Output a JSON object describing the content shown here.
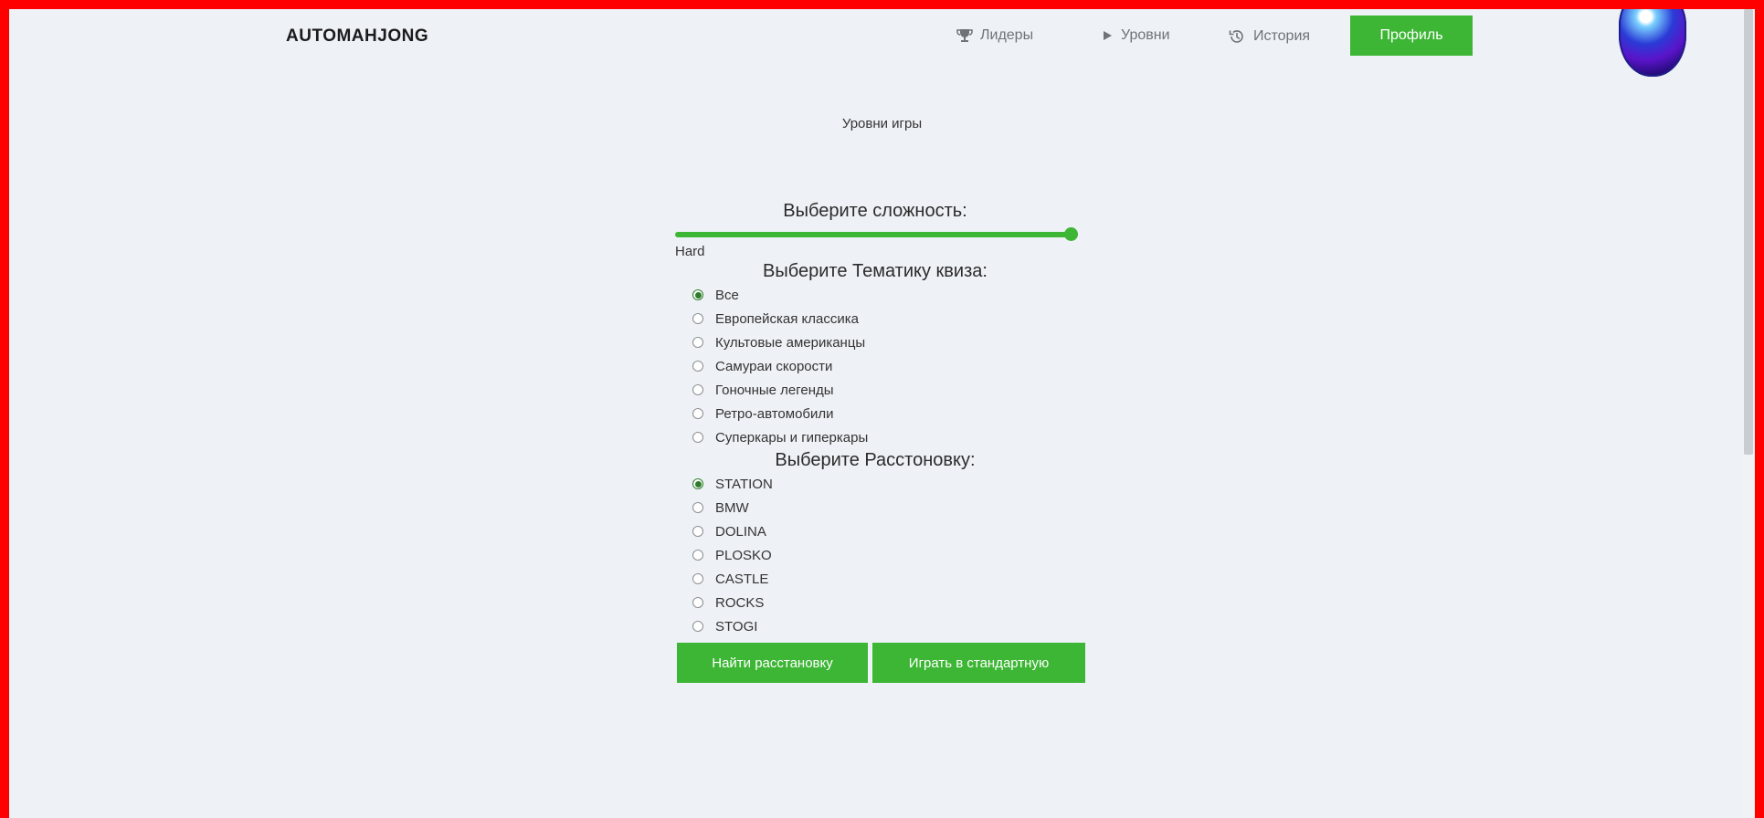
{
  "header": {
    "logo": "AUTOMAHJONG",
    "nav": [
      {
        "label": "Лидеры",
        "icon": "trophy-icon"
      },
      {
        "label": "Уровни",
        "icon": "play-icon"
      },
      {
        "label": "История",
        "icon": "history-icon"
      }
    ],
    "profile_label": "Профиль"
  },
  "page": {
    "subtitle": "Уровни игры"
  },
  "difficulty": {
    "title": "Выберите сложность:",
    "value_label": "Hard",
    "level": 1.0
  },
  "theme": {
    "title": "Выберите Тематику квиза:",
    "options": [
      {
        "label": "Все",
        "checked": true
      },
      {
        "label": "Европейская классика",
        "checked": false
      },
      {
        "label": "Культовые американцы",
        "checked": false
      },
      {
        "label": "Самураи скорости",
        "checked": false
      },
      {
        "label": "Гоночные легенды",
        "checked": false
      },
      {
        "label": "Ретро-автомобили",
        "checked": false
      },
      {
        "label": "Суперкары и гиперкары",
        "checked": false
      }
    ]
  },
  "layout_choice": {
    "title": "Выберите Расстоновку:",
    "options": [
      {
        "label": "STATION",
        "checked": true
      },
      {
        "label": "BMW",
        "checked": false
      },
      {
        "label": "DOLINA",
        "checked": false
      },
      {
        "label": "PLOSKO",
        "checked": false
      },
      {
        "label": "CASTLE",
        "checked": false
      },
      {
        "label": "ROCKS",
        "checked": false
      },
      {
        "label": "STOGI",
        "checked": false
      }
    ]
  },
  "actions": {
    "find_label": "Найти расстановку",
    "play_label": "Играть в стандартную"
  },
  "colors": {
    "accent": "#3cb634",
    "background": "#eef1f6",
    "frame": "#ff0000"
  }
}
